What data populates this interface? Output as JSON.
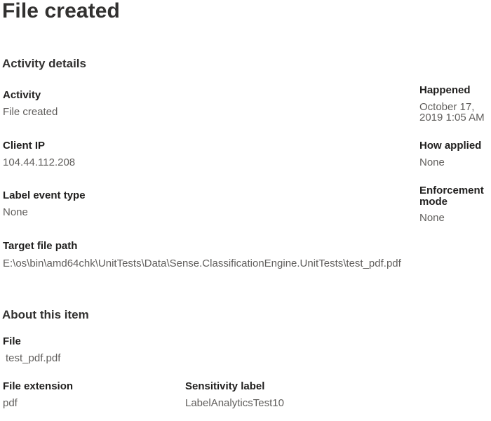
{
  "title": "File created",
  "activity_details": {
    "heading": "Activity details",
    "activity": {
      "label": "Activity",
      "value": "File created"
    },
    "client_ip": {
      "label": "Client IP",
      "value": "104.44.112.208"
    },
    "label_event_type": {
      "label": "Label event type",
      "value": "None"
    },
    "target_file_path": {
      "label": "Target file path",
      "value": "E:\\os\\bin\\amd64chk\\UnitTests\\Data\\Sense.ClassificationEngine.UnitTests\\test_pdf.pdf"
    },
    "happened": {
      "label": "Happened",
      "value": "October 17, 2019 1:05 AM"
    },
    "how_applied": {
      "label": "How applied",
      "value": "None"
    },
    "enforcement_mode": {
      "label": "Enforcement mode",
      "value": "None"
    }
  },
  "about_item": {
    "heading": "About this item",
    "file": {
      "label": "File",
      "value": "test_pdf.pdf"
    },
    "file_extension": {
      "label": "File extension",
      "value": "pdf"
    },
    "sensitivity_label": {
      "label": "Sensitivity label",
      "value": "LabelAnalyticsTest10"
    }
  }
}
